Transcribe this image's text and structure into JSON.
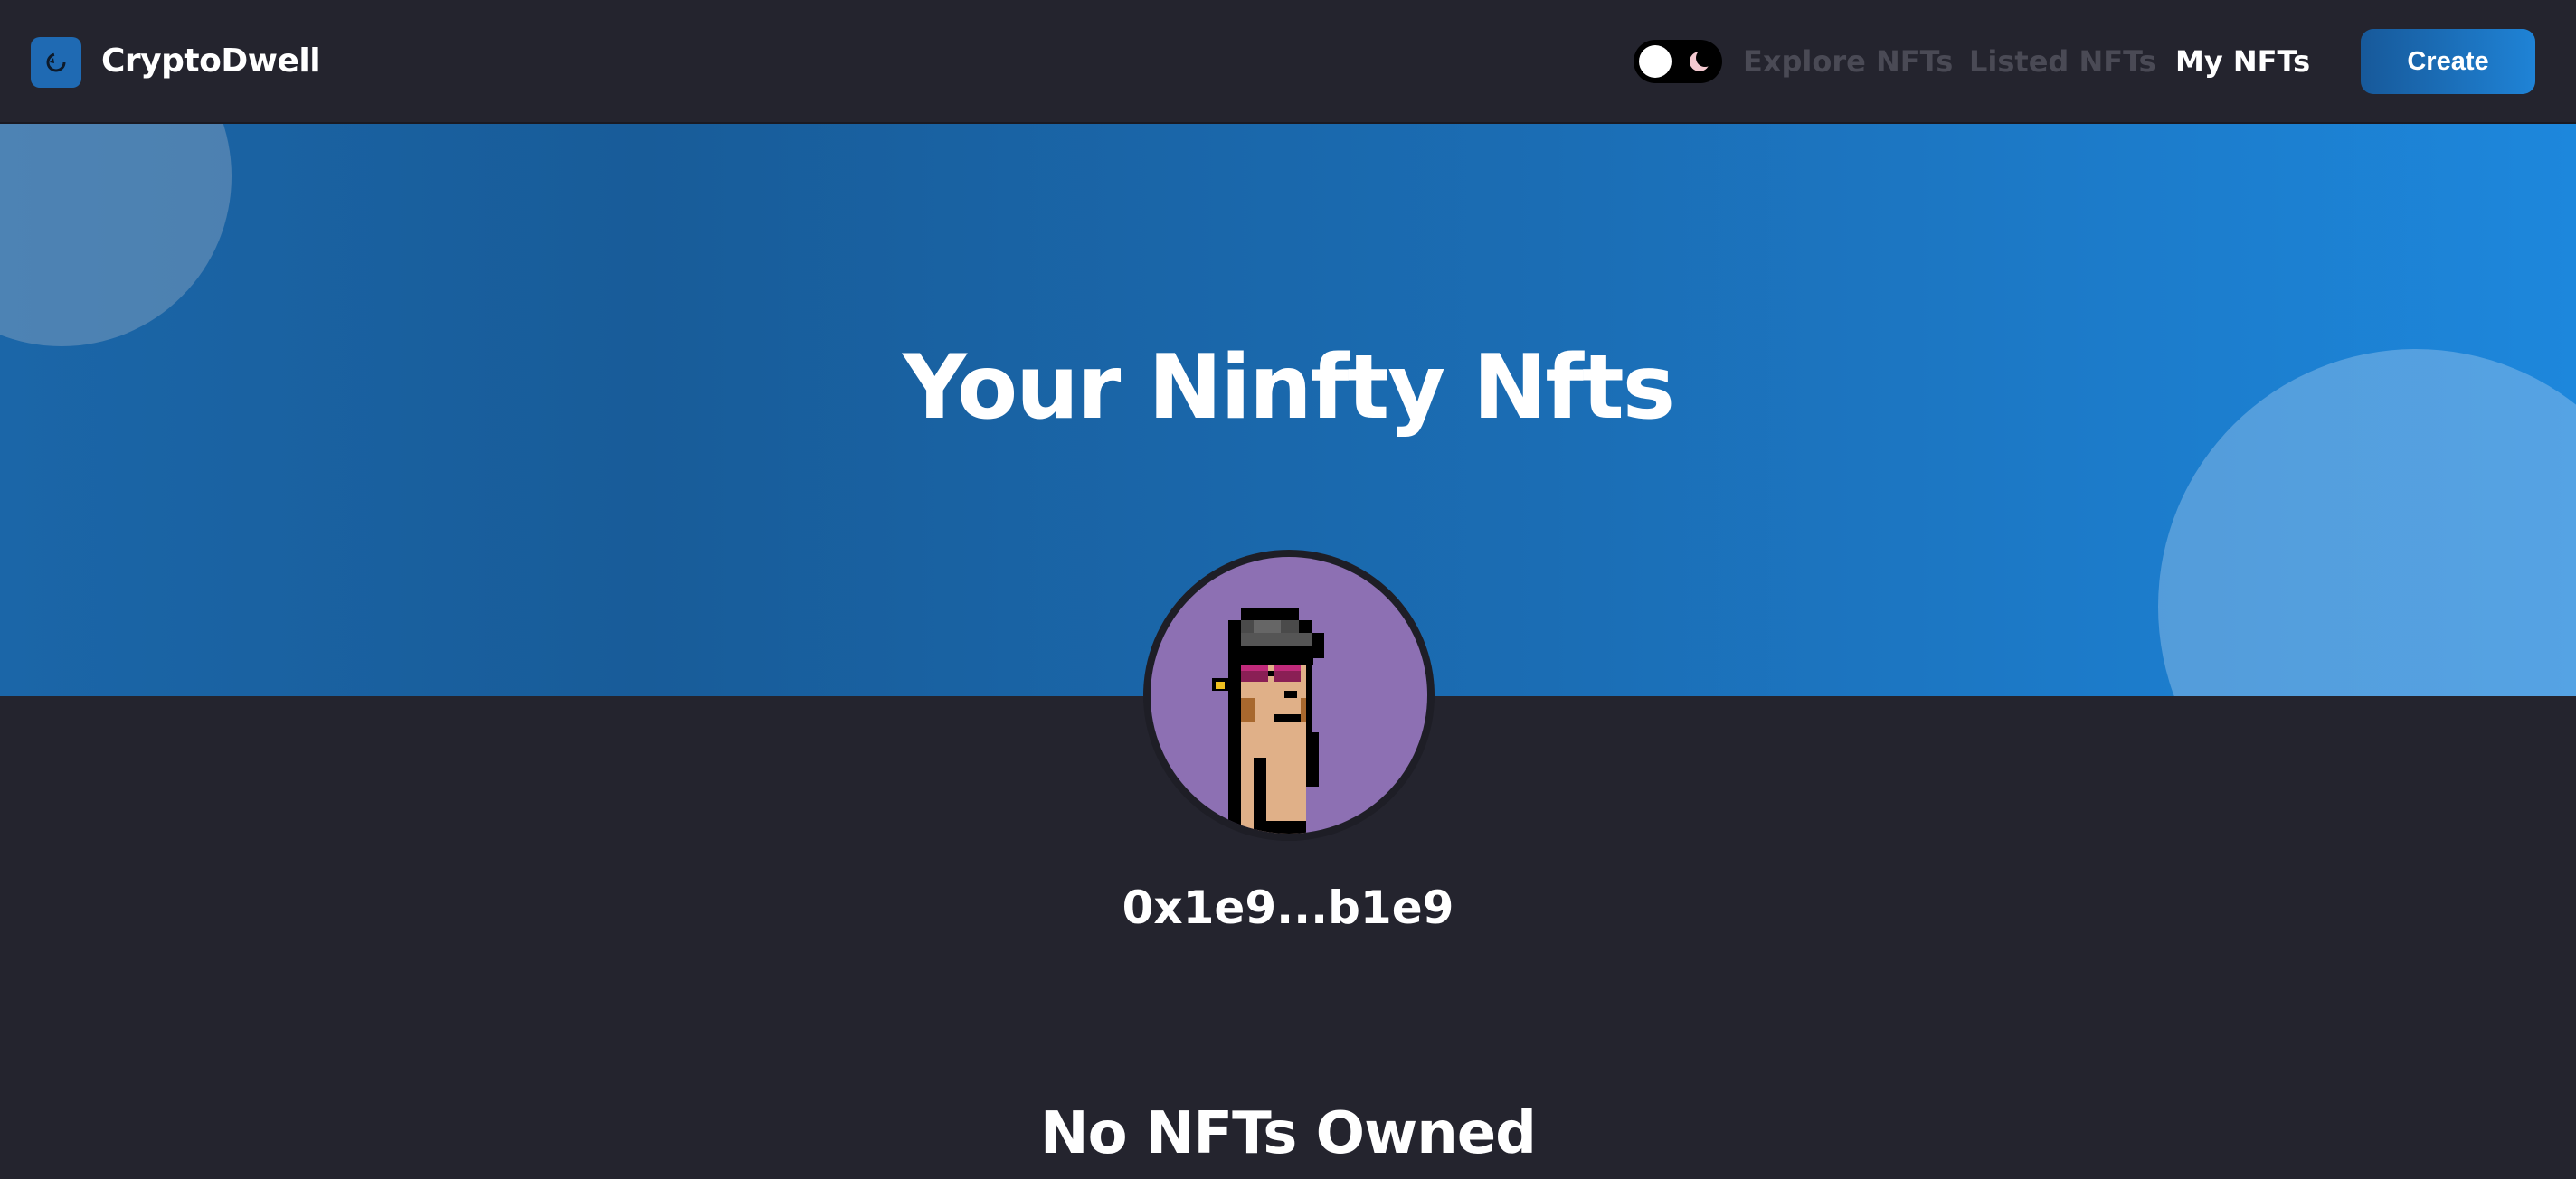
{
  "brand": {
    "name": "CryptoDwell",
    "logo_icon": "refresh-icon"
  },
  "nav": {
    "theme_toggle_icons": [
      "sun-icon",
      "moon-icon"
    ],
    "links": [
      {
        "label": "Explore NFTs",
        "active": false
      },
      {
        "label": "Listed NFTs",
        "active": false
      },
      {
        "label": "My NFTs",
        "active": true
      }
    ],
    "create_label": "Create"
  },
  "hero": {
    "title": "Your Ninfty Nfts"
  },
  "profile": {
    "avatar_icon": "pixel-punk-avatar",
    "address": "0x1e9...b1e9"
  },
  "empty_state": {
    "message": "No NFTs Owned"
  },
  "colors": {
    "background": "#24242e",
    "accent": "#1f83d6",
    "hero_gradient_start": "#1b66a8",
    "hero_gradient_end": "#1d87dc",
    "inactive_link": "#4a4a55",
    "avatar_bg": "#8d70b3"
  }
}
